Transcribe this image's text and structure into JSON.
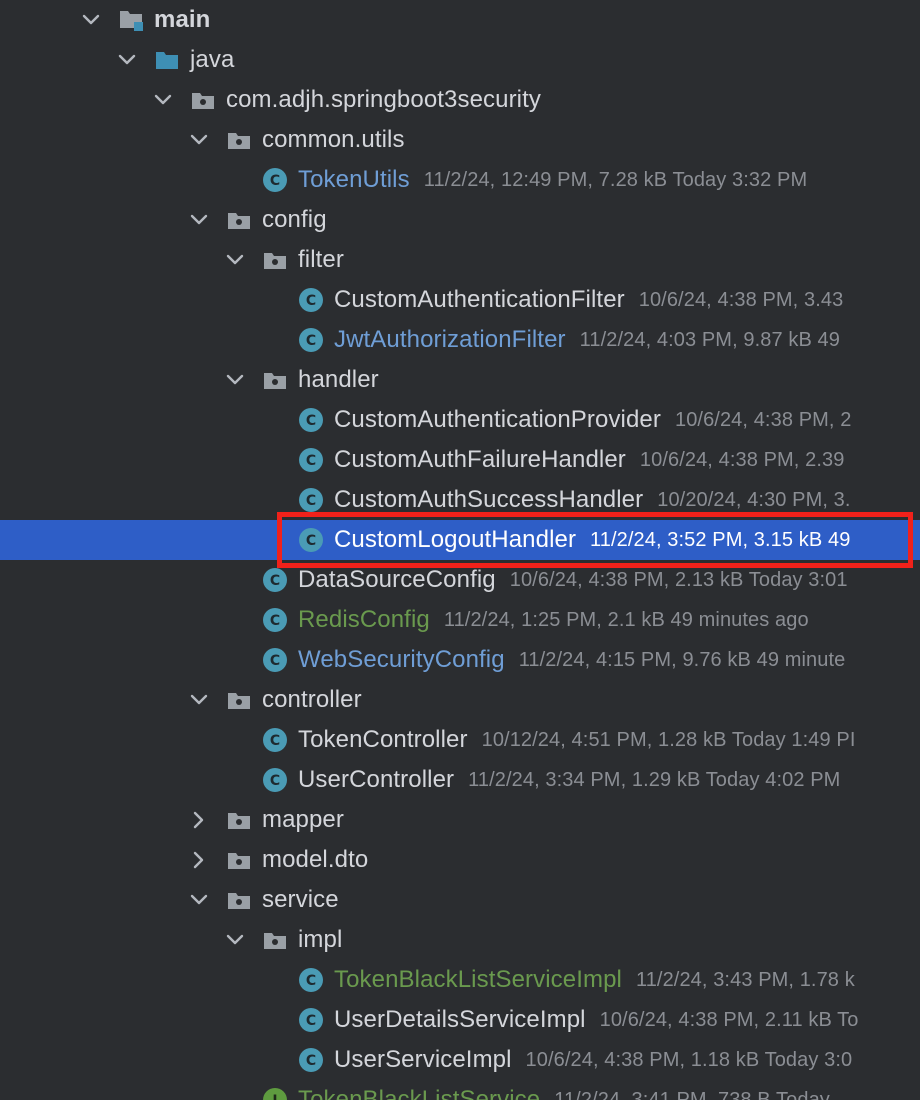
{
  "colors": {
    "background": "#2b2d30",
    "selection": "#2e5ec7",
    "highlight_border": "#f1211a",
    "text_default": "#d4d6db",
    "text_modified": "#6f9ed6",
    "text_added": "#6a9a4e",
    "meta_text": "#8b8e94",
    "class_icon": "#4a9bb5",
    "interface_icon": "#5e9b3f",
    "folder_icon": "#9aa0a6",
    "source_folder_icon": "#3e8fb4"
  },
  "tree": [
    {
      "depth": 0,
      "arrow": "down",
      "icon": "module-folder-icon",
      "name": "main",
      "style": "bold",
      "meta": ""
    },
    {
      "depth": 1,
      "arrow": "down",
      "icon": "source-folder-icon",
      "name": "java",
      "style": "",
      "meta": ""
    },
    {
      "depth": 2,
      "arrow": "down",
      "icon": "package-icon",
      "name": "com.adjh.springboot3security",
      "style": "",
      "meta": ""
    },
    {
      "depth": 3,
      "arrow": "down",
      "icon": "package-icon",
      "name": "common.utils",
      "style": "",
      "meta": ""
    },
    {
      "depth": 4,
      "arrow": "none",
      "icon": "class-icon",
      "name": "TokenUtils",
      "style": "blue",
      "meta": "11/2/24, 12:49 PM, 7.28 kB Today 3:32 PM"
    },
    {
      "depth": 3,
      "arrow": "down",
      "icon": "package-icon",
      "name": "config",
      "style": "",
      "meta": ""
    },
    {
      "depth": 4,
      "arrow": "down",
      "icon": "package-icon",
      "name": "filter",
      "style": "",
      "meta": ""
    },
    {
      "depth": 5,
      "arrow": "none",
      "icon": "class-icon",
      "name": "CustomAuthenticationFilter",
      "style": "",
      "meta": "10/6/24, 4:38 PM, 3.43"
    },
    {
      "depth": 5,
      "arrow": "none",
      "icon": "class-icon",
      "name": "JwtAuthorizationFilter",
      "style": "blue",
      "meta": "11/2/24, 4:03 PM, 9.87 kB 49"
    },
    {
      "depth": 4,
      "arrow": "down",
      "icon": "package-icon",
      "name": "handler",
      "style": "",
      "meta": ""
    },
    {
      "depth": 5,
      "arrow": "none",
      "icon": "class-icon",
      "name": "CustomAuthenticationProvider",
      "style": "",
      "meta": "10/6/24, 4:38 PM, 2"
    },
    {
      "depth": 5,
      "arrow": "none",
      "icon": "class-icon",
      "name": "CustomAuthFailureHandler",
      "style": "",
      "meta": "10/6/24, 4:38 PM, 2.39"
    },
    {
      "depth": 5,
      "arrow": "none",
      "icon": "class-icon",
      "name": "CustomAuthSuccessHandler",
      "style": "",
      "meta": "10/20/24, 4:30 PM, 3."
    },
    {
      "depth": 5,
      "arrow": "none",
      "icon": "class-icon",
      "name": "CustomLogoutHandler",
      "style": "",
      "meta": "11/2/24, 3:52 PM, 3.15 kB 49",
      "selected": true
    },
    {
      "depth": 4,
      "arrow": "none",
      "icon": "class-icon",
      "name": "DataSourceConfig",
      "style": "",
      "meta": "10/6/24, 4:38 PM, 2.13 kB Today 3:01"
    },
    {
      "depth": 4,
      "arrow": "none",
      "icon": "class-icon",
      "name": "RedisConfig",
      "style": "green",
      "meta": "11/2/24, 1:25 PM, 2.1 kB 49 minutes ago"
    },
    {
      "depth": 4,
      "arrow": "none",
      "icon": "class-icon",
      "name": "WebSecurityConfig",
      "style": "blue",
      "meta": "11/2/24, 4:15 PM, 9.76 kB 49 minute"
    },
    {
      "depth": 3,
      "arrow": "down",
      "icon": "package-icon",
      "name": "controller",
      "style": "",
      "meta": ""
    },
    {
      "depth": 4,
      "arrow": "none",
      "icon": "class-icon",
      "name": "TokenController",
      "style": "",
      "meta": "10/12/24, 4:51 PM, 1.28 kB Today 1:49 PI"
    },
    {
      "depth": 4,
      "arrow": "none",
      "icon": "class-icon",
      "name": "UserController",
      "style": "",
      "meta": "11/2/24, 3:34 PM, 1.29 kB Today 4:02 PM"
    },
    {
      "depth": 3,
      "arrow": "right",
      "icon": "package-icon",
      "name": "mapper",
      "style": "",
      "meta": ""
    },
    {
      "depth": 3,
      "arrow": "right",
      "icon": "package-icon",
      "name": "model.dto",
      "style": "",
      "meta": ""
    },
    {
      "depth": 3,
      "arrow": "down",
      "icon": "package-icon",
      "name": "service",
      "style": "",
      "meta": ""
    },
    {
      "depth": 4,
      "arrow": "down",
      "icon": "package-icon",
      "name": "impl",
      "style": "",
      "meta": ""
    },
    {
      "depth": 5,
      "arrow": "none",
      "icon": "class-icon",
      "name": "TokenBlackListServiceImpl",
      "style": "green",
      "meta": "11/2/24, 3:43 PM, 1.78 k"
    },
    {
      "depth": 5,
      "arrow": "none",
      "icon": "class-icon",
      "name": "UserDetailsServiceImpl",
      "style": "",
      "meta": "10/6/24, 4:38 PM, 2.11 kB To"
    },
    {
      "depth": 5,
      "arrow": "none",
      "icon": "class-icon",
      "name": "UserServiceImpl",
      "style": "",
      "meta": "10/6/24, 4:38 PM, 1.18 kB Today 3:0"
    },
    {
      "depth": 4,
      "arrow": "none",
      "icon": "interface-icon",
      "name": "TokenBlackListService",
      "style": "green",
      "meta": "11/2/24, 3:41 PM, 738 B Today"
    }
  ]
}
